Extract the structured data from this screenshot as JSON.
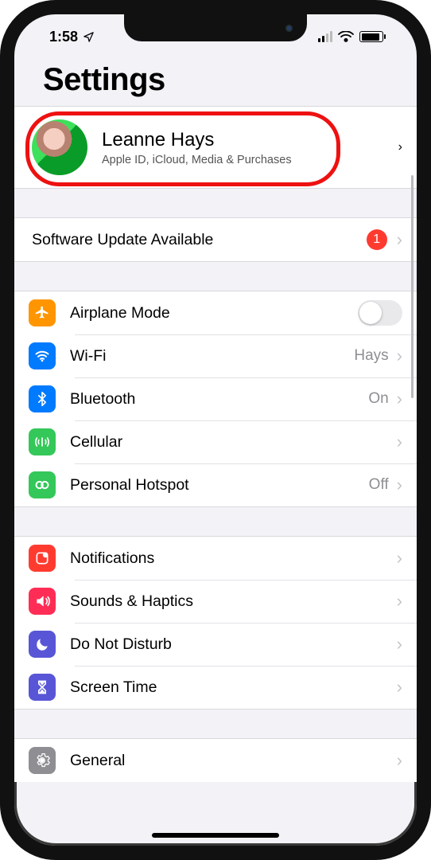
{
  "statusbar": {
    "time": "1:58",
    "location_icon": "location-arrow"
  },
  "title": "Settings",
  "profile": {
    "name": "Leanne Hays",
    "subtitle": "Apple ID, iCloud, Media & Purchases"
  },
  "software_update": {
    "label": "Software Update Available",
    "badge": "1"
  },
  "connectivity": {
    "airplane": {
      "label": "Airplane Mode",
      "on": false
    },
    "wifi": {
      "label": "Wi-Fi",
      "value": "Hays"
    },
    "bluetooth": {
      "label": "Bluetooth",
      "value": "On"
    },
    "cellular": {
      "label": "Cellular"
    },
    "hotspot": {
      "label": "Personal Hotspot",
      "value": "Off"
    }
  },
  "alerts": {
    "notifications": {
      "label": "Notifications"
    },
    "sounds": {
      "label": "Sounds & Haptics"
    },
    "dnd": {
      "label": "Do Not Disturb"
    },
    "screentime": {
      "label": "Screen Time"
    }
  },
  "general": {
    "label": "General"
  }
}
